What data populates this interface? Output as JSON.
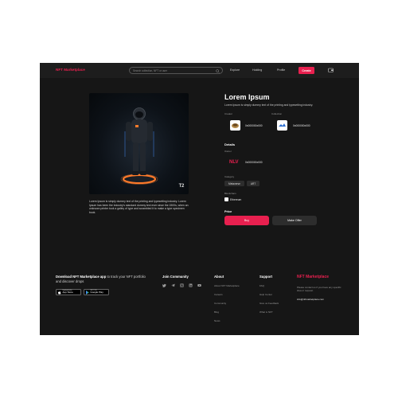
{
  "header": {
    "logo": "NFT Marketplace",
    "search_placeholder": "Search collection, NFT or user",
    "nav": [
      "Explore",
      "Holding",
      "Profile"
    ],
    "create_label": "Create"
  },
  "item": {
    "title": "Lorem Ipsum",
    "subtitle": "Lorem Ipsum is simply dummy text of the printing and typesetting industry.",
    "art_label": "T2",
    "description": "Lorem Ipsum is simply dummy text of the printing and typesetting industry. Lorem Ipsum has been the industry's standard dummy text ever since the 1500s, when an unknown printer took a galley of type and scrambled it to make a type specimen book.",
    "creator_label": "Creator",
    "creator_address": "0x000000x000",
    "collection_label": "Collection",
    "collection_address": "0x000000x000",
    "details_heading": "Details",
    "owner_label": "Owner",
    "owner_address": "0x000000x000",
    "category_label": "Category",
    "categories": [
      "Metaverse",
      "ART"
    ],
    "blockchain_label": "Blockchain",
    "blockchain": "Ethereum",
    "price_heading": "Price",
    "buy_label": "Buy",
    "offer_label": "Make Offer"
  },
  "footer": {
    "app_title_bold": "Download NFT Marketplace app",
    "app_title_rest": " to track your NFT portfolio and discover drops",
    "app_store": {
      "small": "Download on the",
      "big": "App Store"
    },
    "google_play": {
      "small": "GET IT ON",
      "big": "Google Play"
    },
    "community_heading": "Join Community",
    "about_heading": "About",
    "about_links": [
      "About NFT Marketplace",
      "Careers",
      "Community",
      "Blog",
      "News"
    ],
    "support_heading": "Support",
    "support_links": [
      "FAQ",
      "Help Center",
      "Give us Feedback",
      "What is NFT"
    ],
    "brand": "NFT Marketplace",
    "contact_text": "Please contact us if you have any specific idea or request.",
    "email": "info@nftmarketplace.com"
  },
  "colors": {
    "accent": "#e8204f",
    "background": "#161616",
    "header": "#1d1d1d",
    "chip": "#2d2d2d"
  }
}
